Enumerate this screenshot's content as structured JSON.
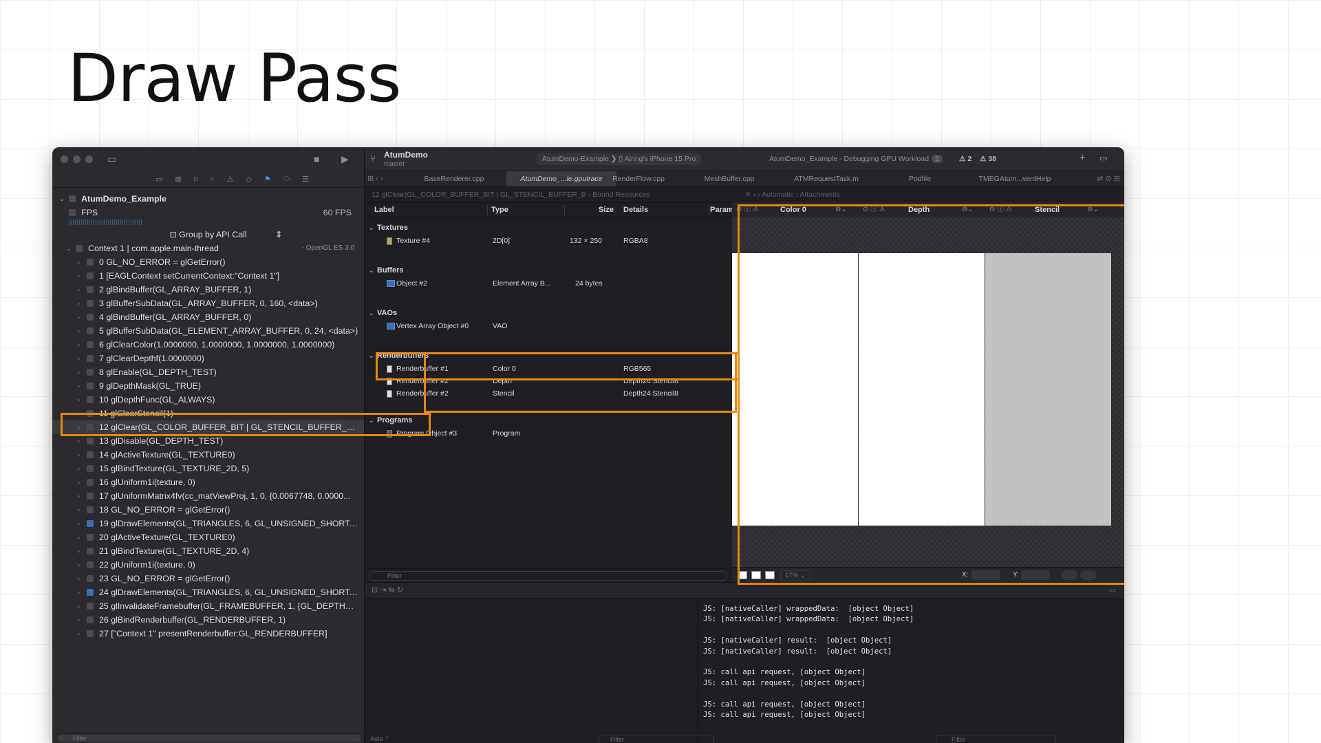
{
  "slide": {
    "title": "Draw Pass"
  },
  "navigator": {
    "root": "AtumDemo_Example",
    "fps_label": "FPS",
    "fps_value": "60 FPS",
    "group_by": "Group by API Call",
    "context": "Context 1 | com.apple.main-thread",
    "context_suffix": "- OpenGL ES 3.0",
    "calls": [
      "0 GL_NO_ERROR = glGetError()",
      "1 [EAGLContext setCurrentContext:\"Context 1\"]",
      "2 glBindBuffer(GL_ARRAY_BUFFER, 1)",
      "3 glBufferSubData(GL_ARRAY_BUFFER, 0, 160, <data>)",
      "4 glBindBuffer(GL_ARRAY_BUFFER, 0)",
      "5 glBufferSubData(GL_ELEMENT_ARRAY_BUFFER, 0, 24, <data>)",
      "6 glClearColor(1.0000000, 1.0000000, 1.0000000, 1.0000000)",
      "7 glClearDepthf(1.0000000)",
      "8 glEnable(GL_DEPTH_TEST)",
      "9 glDepthMask(GL_TRUE)",
      "10 glDepthFunc(GL_ALWAYS)",
      "11 glClearStencil(1)",
      "12 glClear(GL_COLOR_BUFFER_BIT | GL_STENCIL_BUFFER_BIT |...",
      "13 glDisable(GL_DEPTH_TEST)",
      "14 glActiveTexture(GL_TEXTURE0)",
      "15 glBindTexture(GL_TEXTURE_2D, 5)",
      "16 glUniform1i(texture, 0)",
      "17 glUniformMatrix4fv(cc_matViewProj, 1, 0, {0.0067748, 0.0000...",
      "18 GL_NO_ERROR = glGetError()",
      "19 glDrawElements(GL_TRIANGLES, 6, GL_UNSIGNED_SHORT, N...",
      "20 glActiveTexture(GL_TEXTURE0)",
      "21 glBindTexture(GL_TEXTURE_2D, 4)",
      "22 glUniform1i(texture, 0)",
      "23 GL_NO_ERROR = glGetError()",
      "24 glDrawElements(GL_TRIANGLES, 6, GL_UNSIGNED_SHORT, 0...",
      "25 glInvalidateFramebuffer(GL_FRAMEBUFFER, 1, {GL_DEPTH_A...",
      "26 glBindRenderbuffer(GL_RENDERBUFFER, 1)",
      "27 [\"Context 1\" presentRenderbuffer:GL_RENDERBUFFER]"
    ],
    "filter_placeholder": "Filter"
  },
  "toolbar": {
    "scheme_name": "AtumDemo",
    "branch": "master",
    "destination_scheme": "AtumDemo-Example",
    "destination_device": "Airing's iPhone 15 Pro",
    "status": "AtumDemo_Example - Debugging GPU Workload",
    "status_badge": "2",
    "warnings_a": "2",
    "warnings_b": "38"
  },
  "tabs": [
    "BaseRenderer.cpp",
    "AtumDemo_...le.gputrace",
    "RenderFlow.cpp",
    "MeshBuffer.cpp",
    "ATMRequestTask.m",
    "Podfile",
    "TMEGAtum...ventHelp"
  ],
  "jumpbar": {
    "left": "12 glClear(GL_COLOR_BUFFER_BIT | GL_STENCIL_BUFFER_B  ›  Bound Resources",
    "right": "Automatic  ›  Attachments"
  },
  "resources": {
    "headers": {
      "label": "Label",
      "type": "Type",
      "size": "Size",
      "details": "Details",
      "params": "Parame"
    },
    "sections": {
      "textures": "Textures",
      "buffers": "Buffers",
      "vaos": "VAOs",
      "renderbuffers": "Renderbuffers",
      "programs": "Programs"
    },
    "texture": {
      "label": "Texture #4",
      "type": "2D[0]",
      "size": "132 × 250",
      "details": "RGBA8"
    },
    "buffer": {
      "label": "Object #2",
      "type": "Element Array B...",
      "size": "24 bytes"
    },
    "vao": {
      "label": "Vertex Array Object #0",
      "type": "VAO"
    },
    "renderbuffers": [
      {
        "label": "Renderbuffer #1",
        "type": "Color 0",
        "details": "RGB565"
      },
      {
        "label": "Renderbuffer #2",
        "type": "Depth",
        "details": "Depth24 Stencil8"
      },
      {
        "label": "Renderbuffer #2",
        "type": "Stencil",
        "details": "Depth24 Stencil8"
      }
    ],
    "program": {
      "label": "Program Object #3",
      "type": "Program"
    },
    "filter_placeholder": "Filter"
  },
  "attachments": {
    "headers": [
      "Color 0",
      "Depth",
      "Stencil"
    ],
    "colors": [
      "#ffffff",
      "#ffffff",
      "#c2c2c2"
    ],
    "zoom": "17%",
    "x_label": "X:",
    "y_label": "Y:"
  },
  "console": {
    "lines": [
      "JS: [nativeCaller] wrappedData:  [object Object]",
      "JS: [nativeCaller] wrappedData:  [object Object]",
      "",
      "JS: [nativeCaller] result:  [object Object]",
      "JS: [nativeCaller] result:  [object Object]",
      "",
      "JS: call api request, [object Object]",
      "JS: call api request, [object Object]",
      "",
      "JS: call api request, [object Object]",
      "JS: call api request, [object Object]"
    ],
    "auto_label": "Auto ⌃",
    "filter_placeholder": "Filter"
  },
  "colors": {
    "highlight": "#e9870c",
    "selection": "#3a3b3f",
    "accent": "#4c8df6"
  }
}
